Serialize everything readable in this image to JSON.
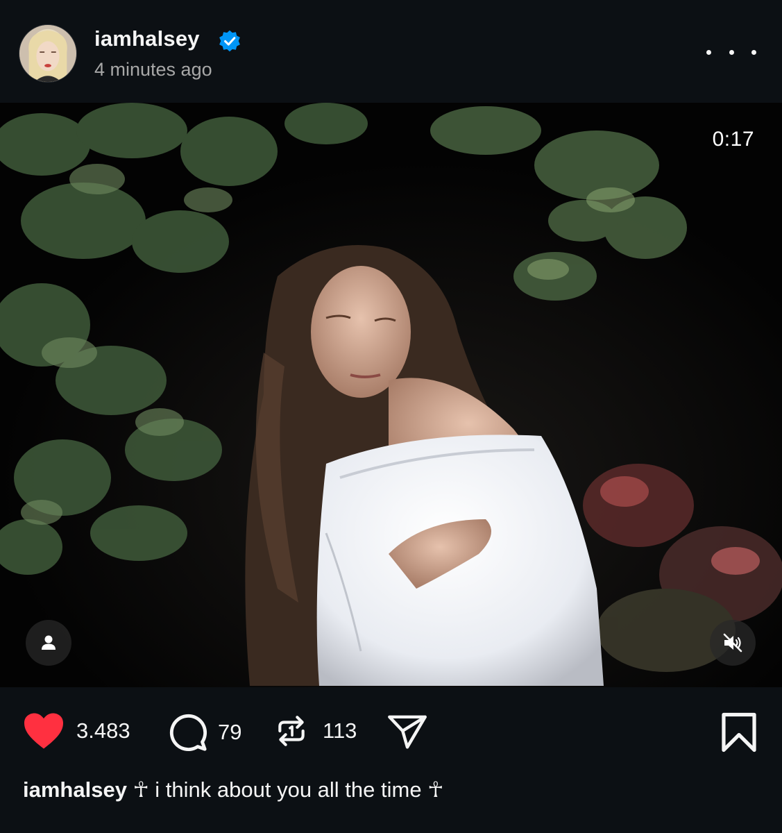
{
  "post": {
    "username": "iamhalsey",
    "timestamp": "4 minutes ago",
    "verified": true
  },
  "video": {
    "duration": "0:17",
    "muted": true
  },
  "actions": {
    "likes": "3.483",
    "comments": "79",
    "reposts": "113",
    "liked": true
  },
  "caption": {
    "username": "iamhalsey",
    "text": "☥ i think about you all the time ☥"
  },
  "icons": {
    "more": "more-horizontal-icon",
    "verified": "verified-badge-icon",
    "tag": "person-tag-icon",
    "mute": "speaker-muted-icon",
    "like": "heart-icon",
    "comment": "comment-bubble-icon",
    "repost": "repost-icon",
    "share": "paper-plane-icon",
    "save": "bookmark-icon"
  },
  "colors": {
    "background": "#0c1014",
    "like": "#ff3040",
    "verified": "#0095f6",
    "secondary_text": "#a8a8a8"
  }
}
